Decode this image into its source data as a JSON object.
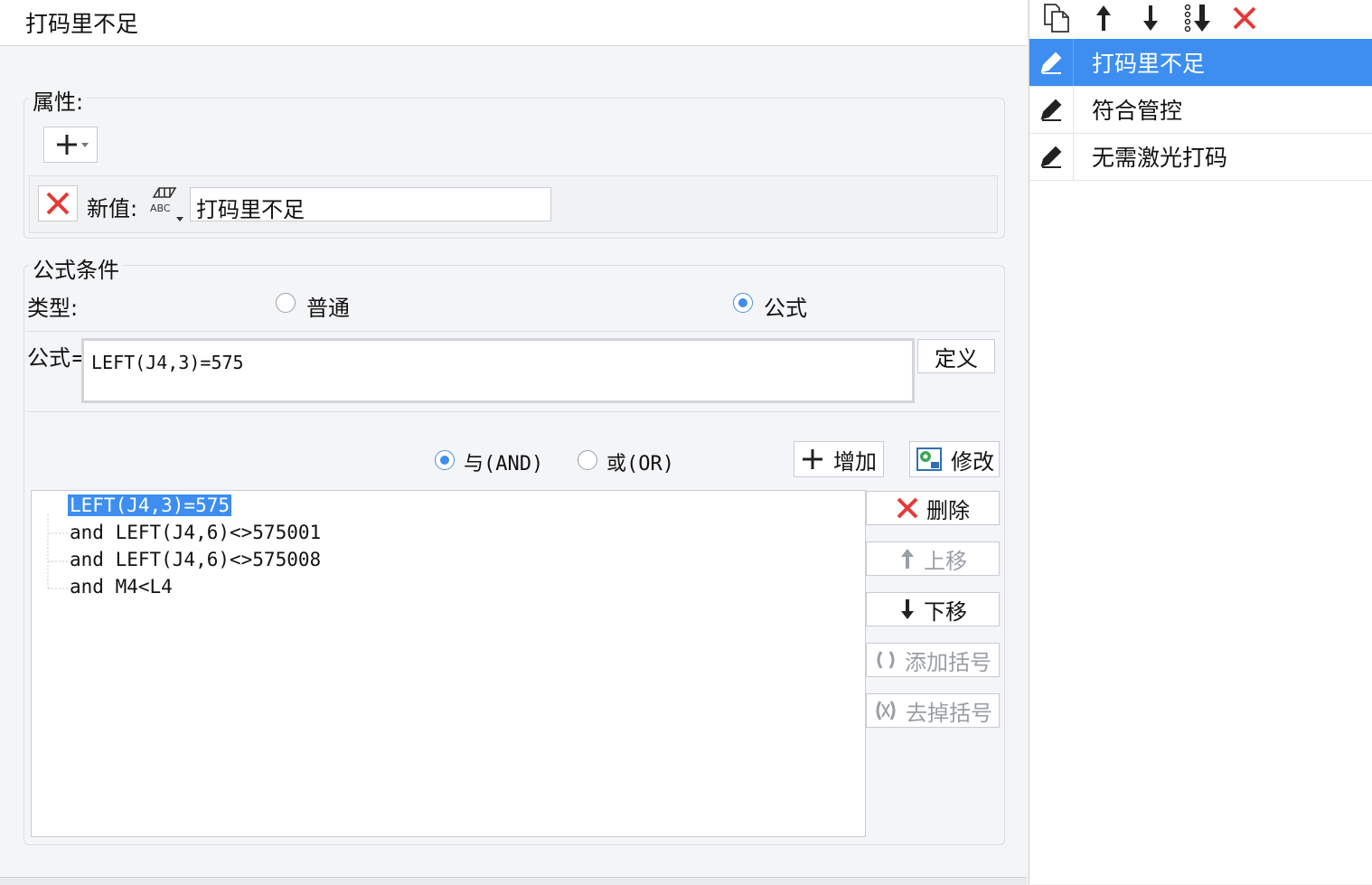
{
  "title": "打码里不足",
  "attributes": {
    "legend": "属性:",
    "new_value_label": "新值:",
    "new_value": "打码里不足"
  },
  "formula_condition": {
    "legend": "公式条件",
    "type_label": "类型:",
    "type_options": {
      "normal": "普通",
      "formula": "公式"
    },
    "type_selected": "formula",
    "formula_label": "公式=",
    "formula_value": "LEFT(J4,3)=575",
    "define_button": "定义",
    "logic_and": "与(AND)",
    "logic_or": "或(OR)",
    "logic_selected": "and",
    "add_button": "增加",
    "modify_button": "修改",
    "delete_button": "删除",
    "move_up_button": "上移",
    "move_down_button": "下移",
    "add_paren_button": "添加括号",
    "remove_paren_button": "去掉括号",
    "conditions": [
      "LEFT(J4,3)=575",
      "and LEFT(J4,6)<>575001",
      "and LEFT(J4,6)<>575008",
      "and M4<L4"
    ],
    "selected_condition_index": 0
  },
  "list": {
    "items": [
      {
        "label": "打码里不足",
        "selected": true
      },
      {
        "label": "符合管控",
        "selected": false
      },
      {
        "label": "无需激光打码",
        "selected": false
      }
    ]
  },
  "colors": {
    "accent": "#3d8ef0",
    "delete_red": "#e53935",
    "selection": "#3d8ef0"
  },
  "icons": [
    "copy-icon",
    "arrow-up-icon",
    "arrow-down-icon",
    "move-bottom-icon",
    "close-icon",
    "pencil-icon",
    "plus-icon",
    "abc-icon",
    "gear-icon",
    "paren-icon"
  ]
}
